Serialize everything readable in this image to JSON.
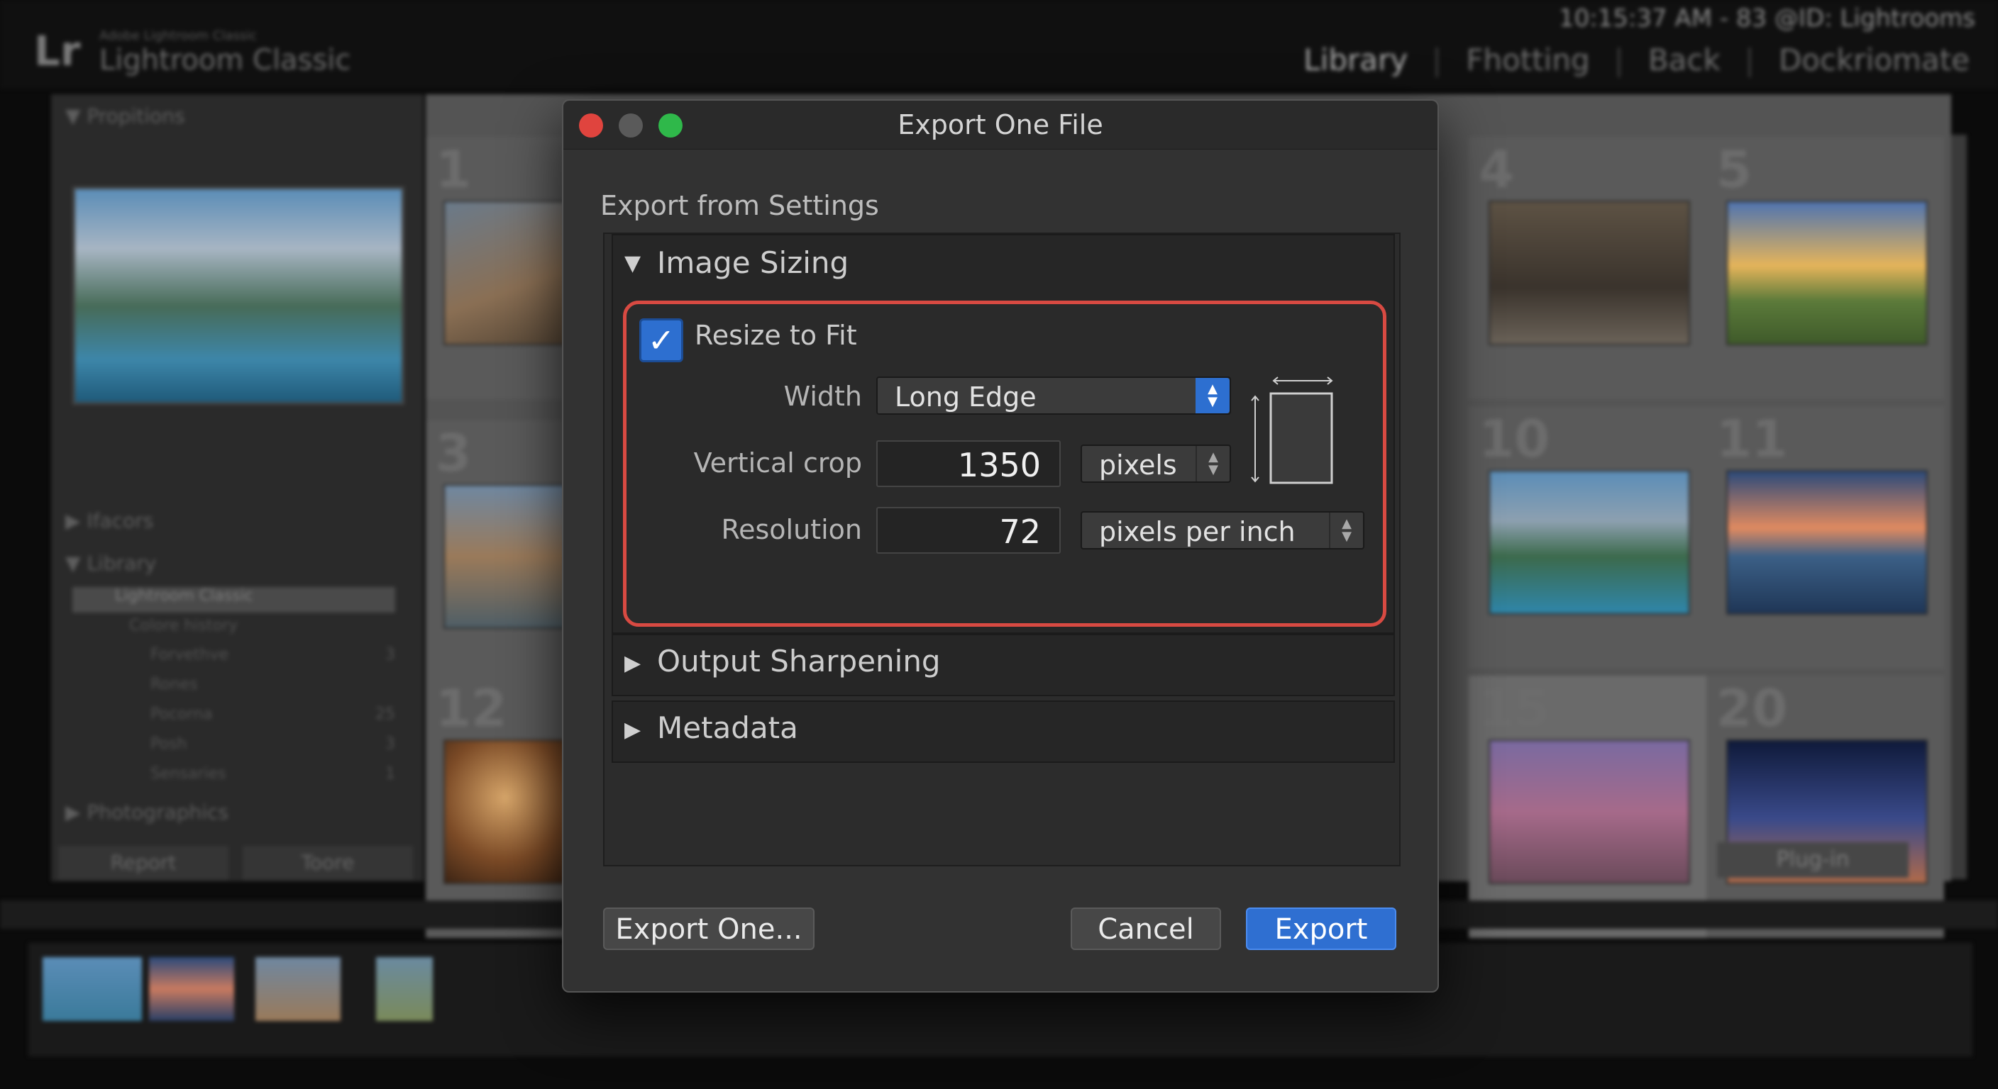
{
  "app": {
    "logo": "Lr",
    "product_small": "Adobe Lightroom Classic",
    "product": "Lightroom Classic",
    "status": "10:15:37 AM - 83 @ID: Lightrooms",
    "modules": [
      "Library",
      "Fhotting",
      "Back",
      "Dockriomate"
    ]
  },
  "left_panel": {
    "navigator": "Propitions",
    "panels": [
      "Ifacors",
      "Library",
      "Photographics"
    ],
    "collections": [
      {
        "label": "Lightroom Classic",
        "count": ""
      },
      {
        "label": "Colore history",
        "count": ""
      },
      {
        "label": "Forvethve",
        "count": "3"
      },
      {
        "label": "Rones",
        "count": ""
      },
      {
        "label": "Pocorna",
        "count": "25"
      },
      {
        "label": "Posh",
        "count": "3"
      },
      {
        "label": "Sensaries",
        "count": "1"
      }
    ],
    "buttons": [
      "Report",
      "Toore"
    ]
  },
  "grid": {
    "cell_numbers": [
      "1",
      "4",
      "5",
      "3",
      "10",
      "11",
      "12",
      "15",
      "20"
    ],
    "plugin_button": "Plug-in"
  },
  "dialog": {
    "title": "Export One File",
    "subheading": "Export from Settings",
    "sections": {
      "image_sizing": "Image Sizing",
      "output_sharpening": "Output Sharpening",
      "metadata": "Metadata"
    },
    "resize": {
      "checkbox_label": "Resize to Fit",
      "checked": true,
      "width_label": "Width",
      "width_value": "Long Edge",
      "vertical_crop_label": "Vertical crop",
      "vertical_crop_value": "1350",
      "vertical_crop_unit": "pixels",
      "resolution_label": "Resolution",
      "resolution_value": "72",
      "resolution_unit": "pixels per inch"
    },
    "buttons": {
      "export_one": "Export One...",
      "cancel": "Cancel",
      "export": "Export"
    },
    "colors": {
      "accent": "#2f6fd1",
      "highlight": "#d84a42",
      "close": "#e0443e",
      "minimize": "#5a5a5a",
      "zoom": "#2fb84a"
    }
  }
}
